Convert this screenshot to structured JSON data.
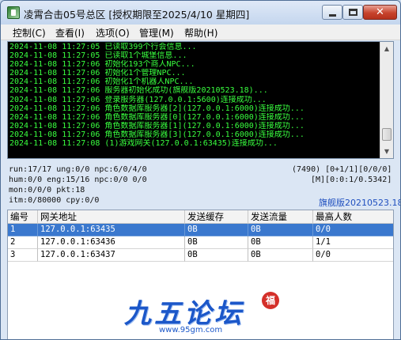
{
  "window": {
    "title": "凌霄合击05号总区 [授权期限至2025/4/10 星期四]"
  },
  "menu": {
    "items": [
      {
        "label": "控制(C)"
      },
      {
        "label": "查看(I)"
      },
      {
        "label": "选项(O)"
      },
      {
        "label": "管理(M)"
      },
      {
        "label": "帮助(H)"
      }
    ]
  },
  "console": {
    "lines": [
      "2024-11-08 11:27:05 已读取399个行会信息...",
      "2024-11-08 11:27:05 已读取1个城堡信息...",
      "2024-11-08 11:27:06 初始化193个商人NPC...",
      "2024-11-08 11:27:06 初始化1个管理NPC...",
      "2024-11-08 11:27:06 初始化1个机器人NPC...",
      "2024-11-08 11:27:06 服务器初始化成功(旗舰版20210523.18)...",
      "2024-11-08 11:27:06 登录服务器(127.0.0.1:5600)连接成功...",
      "2024-11-08 11:27:06 角色数据库服务器[2](127.0.0.1:6000)连接成功...",
      "2024-11-08 11:27:06 角色数据库服务器[0](127.0.0.1:6000)连接成功...",
      "2024-11-08 11:27:06 角色数据库服务器[1](127.0.0.1:6000)连接成功...",
      "2024-11-08 11:27:06 角色数据库服务器[3](127.0.0.1:6000)连接成功...",
      "2024-11-08 11:27:08 (1)游戏网关(127.0.0.1:63435)连接成功..."
    ],
    "text_color": "#39ff3f"
  },
  "status": {
    "run": "run:17/17 ung:0/0 npc:6/0/4/0",
    "hum": "hum:0/0 eng:15/16 npc:0/0 0/0",
    "mon": "mon:0/0/0 pkt:18",
    "itm": "itm:0/80000 cpy:0/0",
    "right1": "(7490) [0+1/1][0/0/0]",
    "right2": "[M][0:0:1/0.5342]",
    "edition": "旗舰版20210523.18"
  },
  "table": {
    "columns": [
      "编号",
      "网关地址",
      "发送缓存",
      "发送流量",
      "最高人数"
    ],
    "rows": [
      [
        "1",
        "127.0.0.1:63435",
        "0B",
        "0B",
        "0/0"
      ],
      [
        "2",
        "127.0.0.1:63436",
        "0B",
        "0B",
        "1/1"
      ],
      [
        "3",
        "127.0.0.1:63437",
        "0B",
        "0B",
        "0/0"
      ]
    ],
    "selected_row": 0,
    "selection_color": "#3a78ce"
  },
  "watermark": {
    "logo_text": "九五论坛",
    "url": "www.95gm.com",
    "seal": "福"
  }
}
